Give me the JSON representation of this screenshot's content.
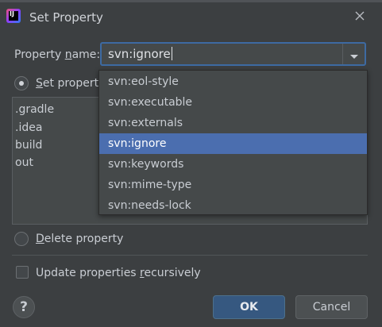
{
  "window": {
    "title": "Set Property",
    "app_icon": "intellij-app-icon",
    "close_icon": "close-icon"
  },
  "property_name": {
    "label_prefix": "Property ",
    "label_mnemonic": "n",
    "label_suffix": "ame:",
    "value": "svn:ignore",
    "dropdown_icon": "chevron-down-icon",
    "options": [
      "svn:eol-style",
      "svn:executable",
      "svn:externals",
      "svn:ignore",
      "svn:keywords",
      "svn:mime-type",
      "svn:needs-lock"
    ],
    "selected_index": 3
  },
  "set_property": {
    "label_mnemonic": "S",
    "label_rest": "et property",
    "checked": true
  },
  "value_text": {
    "lines": [
      ".gradle",
      ".idea",
      "build",
      "out"
    ]
  },
  "delete_property": {
    "label_mnemonic": "D",
    "label_rest": "elete property",
    "checked": false
  },
  "recursive": {
    "label_prefix": "Update properties ",
    "label_mnemonic": "r",
    "label_suffix": "ecursively",
    "checked": false
  },
  "buttons": {
    "help": "?",
    "ok": "OK",
    "cancel": "Cancel"
  },
  "colors": {
    "background": "#3c3f41",
    "field": "#45494a",
    "focus_border": "#3d6aa2",
    "selection": "#4b6eaf",
    "ok_button": "#365880"
  }
}
